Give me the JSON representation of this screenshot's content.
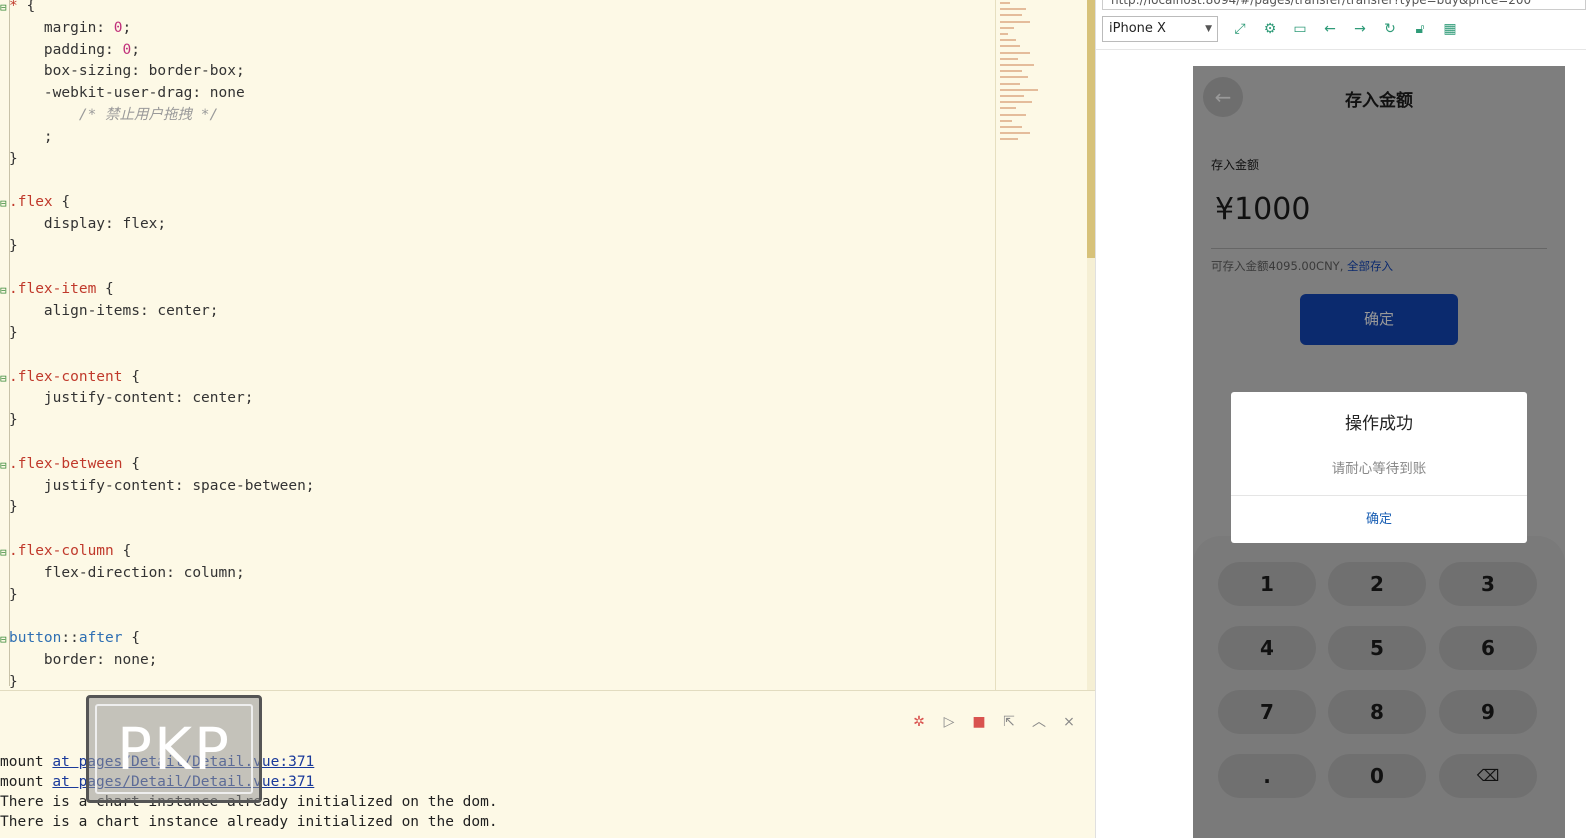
{
  "editor": {
    "lines": [
      {
        "fold": "⊟",
        "parts": [
          [
            "sel",
            "*"
          ],
          [
            "",
            " {"
          ]
        ]
      },
      {
        "parts": [
          [
            "prop",
            "    margin: "
          ],
          [
            "num",
            "0"
          ],
          [
            "",
            ";"
          ]
        ]
      },
      {
        "parts": [
          [
            "prop",
            "    padding: "
          ],
          [
            "num",
            "0"
          ],
          [
            "",
            ";"
          ]
        ]
      },
      {
        "parts": [
          [
            "prop",
            "    box-sizing: border-box;"
          ]
        ]
      },
      {
        "parts": [
          [
            "prop",
            "    -webkit-user-drag: none"
          ]
        ]
      },
      {
        "parts": [
          [
            "cmt",
            "        /* 禁止用户拖拽 */"
          ]
        ]
      },
      {
        "parts": [
          [
            "",
            "    ;"
          ]
        ]
      },
      {
        "parts": [
          [
            "",
            "}"
          ]
        ]
      },
      {
        "parts": [
          [
            "",
            ""
          ]
        ]
      },
      {
        "fold": "⊟",
        "parts": [
          [
            "sel",
            ".flex"
          ],
          [
            "",
            " {"
          ]
        ]
      },
      {
        "parts": [
          [
            "prop",
            "    display: flex;"
          ]
        ]
      },
      {
        "parts": [
          [
            "",
            "}"
          ]
        ]
      },
      {
        "parts": [
          [
            "",
            ""
          ]
        ]
      },
      {
        "fold": "⊟",
        "parts": [
          [
            "sel",
            ".flex-item"
          ],
          [
            "",
            " {"
          ]
        ]
      },
      {
        "parts": [
          [
            "prop",
            "    align-items: center;"
          ]
        ]
      },
      {
        "parts": [
          [
            "",
            "}"
          ]
        ]
      },
      {
        "parts": [
          [
            "",
            ""
          ]
        ]
      },
      {
        "fold": "⊟",
        "parts": [
          [
            "sel",
            ".flex-content"
          ],
          [
            "",
            " {"
          ]
        ]
      },
      {
        "parts": [
          [
            "prop",
            "    justify-content: center;"
          ]
        ]
      },
      {
        "parts": [
          [
            "",
            "}"
          ]
        ]
      },
      {
        "parts": [
          [
            "",
            ""
          ]
        ]
      },
      {
        "fold": "⊟",
        "parts": [
          [
            "sel",
            ".flex-between"
          ],
          [
            "",
            " {"
          ]
        ]
      },
      {
        "parts": [
          [
            "prop",
            "    justify-content: space-between;"
          ]
        ]
      },
      {
        "parts": [
          [
            "",
            "}"
          ]
        ]
      },
      {
        "parts": [
          [
            "",
            ""
          ]
        ]
      },
      {
        "fold": "⊟",
        "parts": [
          [
            "sel",
            ".flex-column"
          ],
          [
            "",
            " {"
          ]
        ]
      },
      {
        "parts": [
          [
            "prop",
            "    flex-direction: column;"
          ]
        ]
      },
      {
        "parts": [
          [
            "",
            "}"
          ]
        ]
      },
      {
        "parts": [
          [
            "",
            ""
          ]
        ]
      },
      {
        "fold": "⊟",
        "parts": [
          [
            "tag",
            "button"
          ],
          [
            "",
            "::"
          ],
          [
            "tag",
            "after"
          ],
          [
            "",
            " {"
          ]
        ]
      },
      {
        "parts": [
          [
            "prop",
            "    border: none;"
          ]
        ]
      },
      {
        "parts": [
          [
            "",
            "}"
          ]
        ]
      }
    ]
  },
  "console": {
    "tool_icons": [
      "bug-icon",
      "play-icon",
      "stop-icon",
      "export-icon",
      "collapse-icon",
      "clear-icon"
    ],
    "watermark": "PKP",
    "logs": [
      {
        "prefix": "mount ",
        "link": "at pages/Detail/Detail.vue:371"
      },
      {
        "prefix": "mount ",
        "link": "at pages/Detail/Detail.vue:371"
      },
      {
        "prefix": "There is a chart instance already initialized on the dom.",
        "link": ""
      },
      {
        "prefix": "There is a chart instance already initialized on the dom.",
        "link": ""
      }
    ]
  },
  "browser": {
    "url": "http://localhost:8094/#/pages/transfer/transfer?type=buy&price=200",
    "device": "iPhone X",
    "tool_icons": [
      "rotate-icon",
      "settings-icon",
      "console-icon",
      "back-arrow-icon",
      "forward-arrow-icon",
      "refresh-icon",
      "lock-icon",
      "qrcode-icon"
    ]
  },
  "phone": {
    "title": "存入金额",
    "amount_label": "存入金额",
    "amount_value": "¥1000",
    "available_text": "可存入金额4095.00CNY,",
    "available_link": "全部存入",
    "confirm_label": "确定",
    "keys": [
      "1",
      "2",
      "3",
      "4",
      "5",
      "6",
      "7",
      "8",
      "9",
      ".",
      "0",
      "⌫"
    ],
    "modal": {
      "title": "操作成功",
      "message": "请耐心等待到账",
      "ok_label": "确定"
    }
  }
}
